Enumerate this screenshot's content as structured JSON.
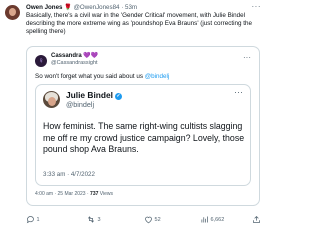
{
  "tweet": {
    "author_name": "Owen Jones",
    "author_badge": "🌹",
    "author_handle": "@OwenJones84",
    "separator": "·",
    "age": "53m",
    "text": "Basically, there's a civil war in the 'Gender Critical' movement, with Julie Bindel describing the more extreme wing as 'poundshop Eva Brauns' (just correcting the spelling there)",
    "more_label": "···"
  },
  "quote": {
    "author_name": "Cassandra",
    "author_emoji": "💜💜",
    "author_handle": "@Cassandrassight",
    "more_label": "···",
    "text_prefix": "So won't forget what you said about us ",
    "text_link": "@bindelj",
    "timestamp": "4:00 am · 25 Mar 2023",
    "views_count": "737",
    "views_label": "Views",
    "inner": {
      "author_name": "Julie Bindel",
      "author_handle": "@bindelj",
      "more_label": "···",
      "text": "How feminist. The same right-wing cultists slagging me off re my crowd justice campaign? Lovely, those pound shop Ava Brauns.",
      "timestamp": "3:33 am · 4/7/2022"
    }
  },
  "actions": {
    "reply_count": "1",
    "retweet_count": "3",
    "like_count": "52",
    "views_count": "6,662"
  },
  "colors": {
    "link": "#1d9bf0",
    "muted": "#536471",
    "border": "#cfd9de"
  }
}
